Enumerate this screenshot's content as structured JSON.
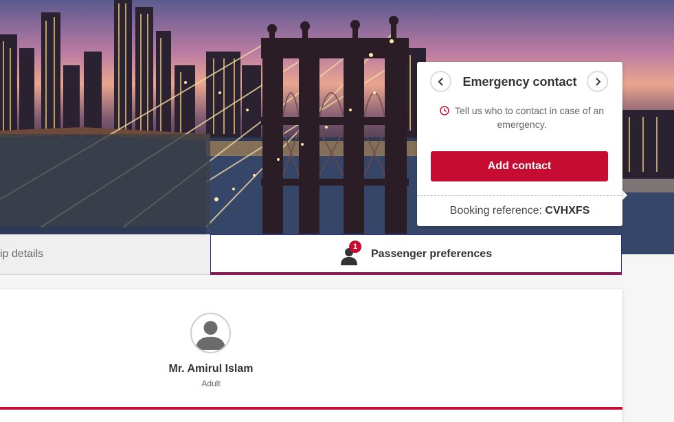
{
  "emergency_card": {
    "title": "Emergency contact",
    "prev_icon": "chevron-left-icon",
    "next_icon": "chevron-right-icon",
    "message": "Tell us who to contact in case of an emergency.",
    "add_button_label": "Add contact",
    "booking_ref_label": "Booking reference:",
    "booking_ref_value": "CVHXFS"
  },
  "tabs": {
    "trip_details_label": "ip details",
    "passenger_prefs_label": "Passenger preferences",
    "passenger_prefs_badge": "1"
  },
  "passenger": {
    "name": "Mr. Amirul Islam",
    "type": "Adult"
  },
  "colors": {
    "accent_red": "#c60c30",
    "tab_underline": "#8b1a5a"
  }
}
